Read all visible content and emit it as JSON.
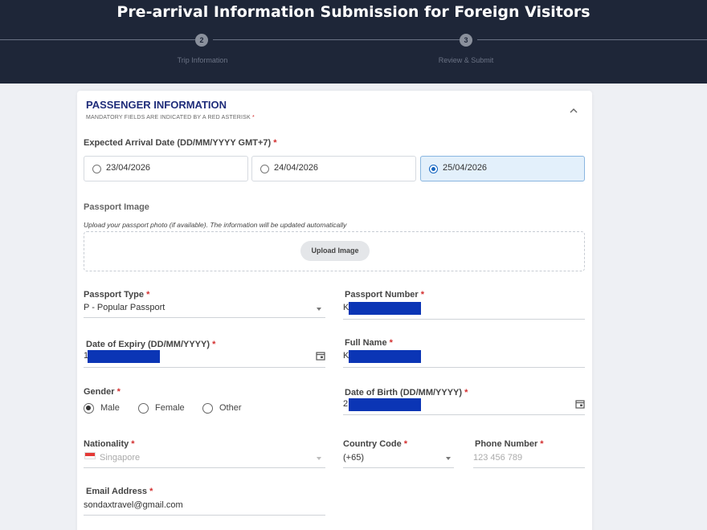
{
  "header": {
    "title": "Pre-arrival Information Submission for Foreign Visitors",
    "steps": [
      {
        "number": "2",
        "label": "Trip Information"
      },
      {
        "number": "3",
        "label": "Review & Submit"
      }
    ]
  },
  "section": {
    "title": "PASSENGER INFORMATION",
    "subtitle": "MANDATORY FIELDS ARE INDICATED BY A RED ASTERISK",
    "required_mark": "*"
  },
  "arrival": {
    "label": "Expected Arrival Date (DD/MM/YYYY GMT+7)",
    "options": [
      "23/04/2026",
      "24/04/2026",
      "25/04/2026"
    ],
    "selected": "25/04/2026"
  },
  "passport_image": {
    "label": "Passport Image",
    "hint": "Upload your passport photo (if available). The information will be updated automatically",
    "button": "Upload Image"
  },
  "fields": {
    "passport_type": {
      "label": "Passport Type",
      "value": "P - Popular Passport"
    },
    "passport_number": {
      "label": "Passport Number",
      "visible_prefix": "K"
    },
    "expiry": {
      "label": "Date of Expiry (DD/MM/YYYY)",
      "visible_prefix": "1"
    },
    "full_name": {
      "label": "Full Name",
      "visible_prefix": "K"
    },
    "gender": {
      "label": "Gender",
      "options": [
        "Male",
        "Female",
        "Other"
      ],
      "selected": "Male"
    },
    "dob": {
      "label": "Date of Birth (DD/MM/YYYY)",
      "visible_prefix": "2"
    },
    "nationality": {
      "label": "Nationality",
      "placeholder": "Singapore"
    },
    "country_code": {
      "label": "Country Code",
      "value": "(+65)"
    },
    "phone": {
      "label": "Phone Number",
      "placeholder": "123 456 789"
    },
    "email": {
      "label": "Email Address",
      "value": "sondaxtravel@gmail.com"
    }
  },
  "colors": {
    "header_bg": "#1e2638",
    "title_blue": "#1f2d7a",
    "required_red": "#d32f2f",
    "selected_bg": "#e3f0fb",
    "redaction": "#0b35b5"
  },
  "icons": {
    "collapse": "chevron-up-icon",
    "calendar": "calendar-icon",
    "dropdown": "caret-down-icon",
    "flag": "singapore-flag-icon"
  }
}
